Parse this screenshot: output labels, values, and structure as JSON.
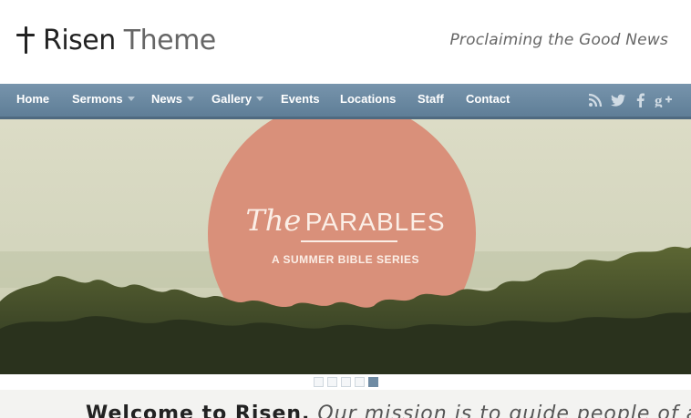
{
  "header": {
    "logo_primary": "Risen",
    "logo_secondary": "Theme",
    "tagline": "Proclaiming the Good News"
  },
  "nav": {
    "items": [
      {
        "label": "Home",
        "has_submenu": false
      },
      {
        "label": "Sermons",
        "has_submenu": true
      },
      {
        "label": "News",
        "has_submenu": true
      },
      {
        "label": "Gallery",
        "has_submenu": true
      },
      {
        "label": "Events",
        "has_submenu": false
      },
      {
        "label": "Locations",
        "has_submenu": false
      },
      {
        "label": "Staff",
        "has_submenu": false
      },
      {
        "label": "Contact",
        "has_submenu": false
      }
    ],
    "social_icons": [
      "rss-icon",
      "twitter-icon",
      "facebook-icon",
      "google-plus-icon"
    ]
  },
  "slider": {
    "title_script": "The",
    "title_main": "PARABLES",
    "subtitle": "A SUMMER BIBLE SERIES",
    "slide_count": 5,
    "active_slide": 5
  },
  "welcome": {
    "heading": "Welcome to Risen.",
    "text": "Our mission is to guide people of all"
  },
  "colors": {
    "nav_bg": "#6a88a1",
    "circle": "#d9907a",
    "accent": "#6f8ba3"
  }
}
